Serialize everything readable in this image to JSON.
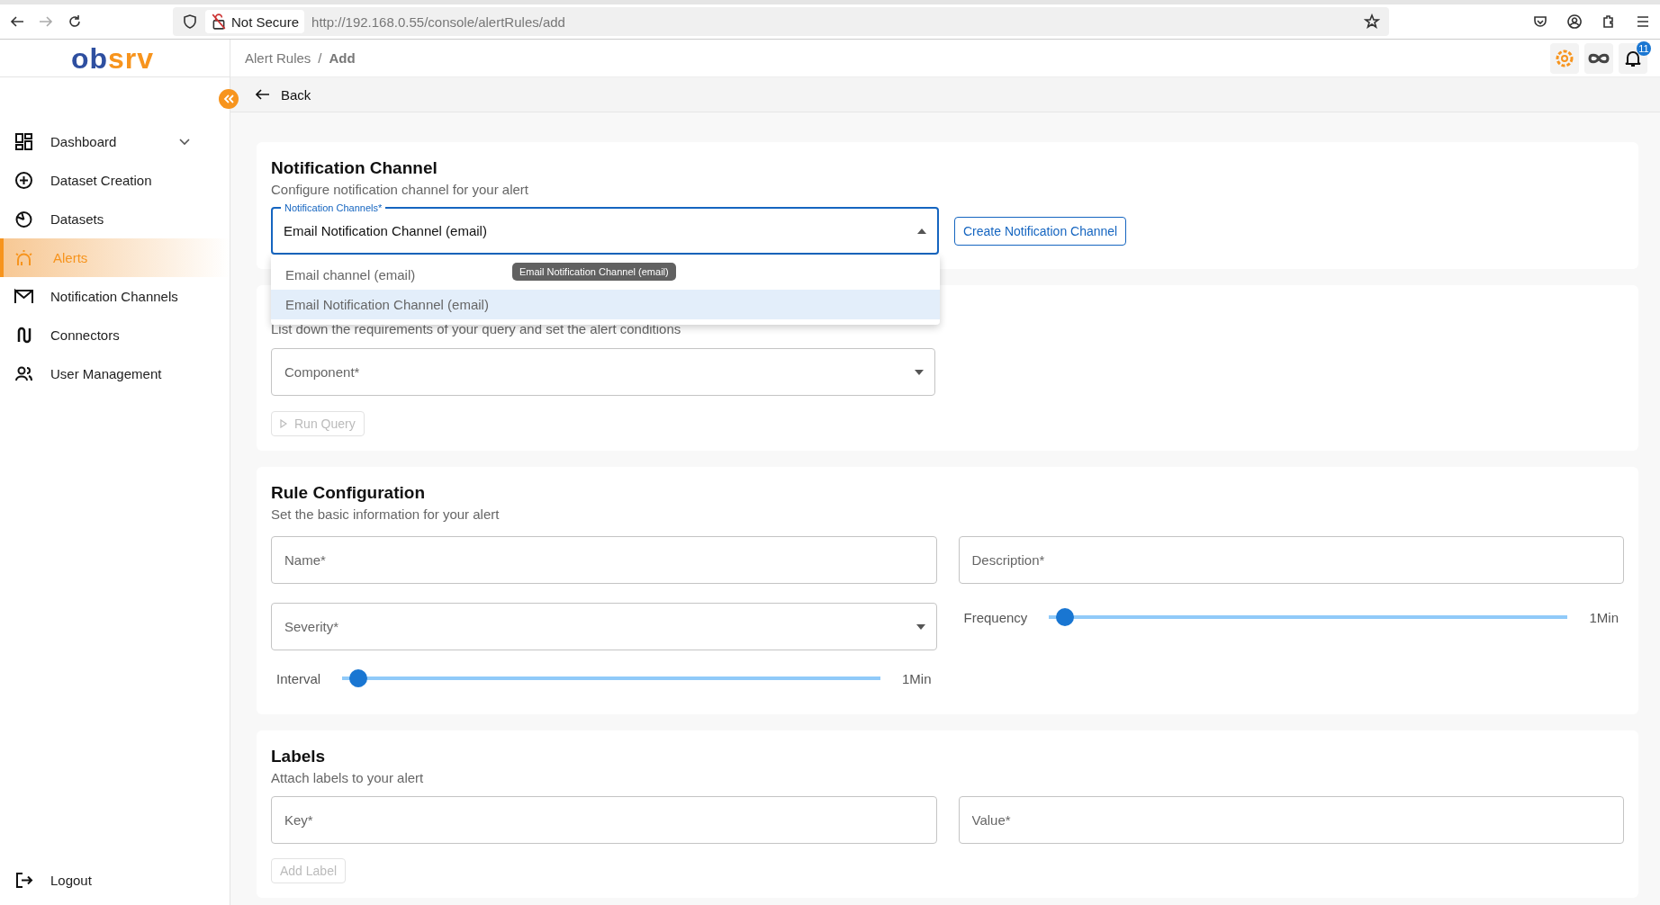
{
  "browser": {
    "security": "Not Secure",
    "url": "http://192.168.0.55/console/alertRules/add"
  },
  "logo": [
    "ob",
    "srv"
  ],
  "header": {
    "breadcrumbs": [
      {
        "label": "Alert Rules",
        "current": false
      },
      {
        "label": "Add",
        "current": true
      }
    ],
    "separator": "/",
    "notification_count": "11"
  },
  "back": "Back",
  "sidebar": {
    "items": [
      {
        "label": "Dashboard",
        "selected": false,
        "expanded": false
      },
      {
        "label": "Dataset Creation",
        "selected": false
      },
      {
        "label": "Datasets",
        "selected": false
      },
      {
        "label": "Alerts",
        "selected": true
      },
      {
        "label": "Notification Channels",
        "selected": false
      },
      {
        "label": "Connectors",
        "selected": false
      },
      {
        "label": "User Management",
        "selected": false
      }
    ],
    "logout": "Logout"
  },
  "notification_channel": {
    "title": "Notification Channel",
    "subtitle": "Configure notification channel for your alert",
    "select": {
      "label": "Notification Channels*",
      "value": "Email Notification Channel (email)",
      "open": true
    },
    "button": "Create Notification Channel",
    "options": [
      {
        "label": "Email channel (email)",
        "selected": false
      },
      {
        "label": "Email Notification Channel (email)",
        "selected": true
      }
    ],
    "tooltip": "Email Notification Channel (email)"
  },
  "query": {
    "subtitle": "List down the requirements of your query and set the alert conditions",
    "component": {
      "placeholder": "Component*"
    },
    "button": {
      "label": "Run Query",
      "disabled": true
    }
  },
  "rule_configuration": {
    "title": "Rule Configuration",
    "subtitle": "Set the basic information for your alert",
    "name": {
      "placeholder": "Name*"
    },
    "description": {
      "placeholder": "Description*"
    },
    "severity": {
      "placeholder": "Severity*"
    },
    "frequency": {
      "label": "Frequency",
      "level": 0.03,
      "reading": "1Min"
    },
    "interval": {
      "label": "Interval",
      "level": 0.03,
      "reading": "1Min"
    }
  },
  "labels": {
    "title": "Labels",
    "subtitle": "Attach labels to your alert",
    "key": {
      "placeholder": "Key*"
    },
    "value": {
      "placeholder": "Value*"
    },
    "button": {
      "label": "Add Label",
      "disabled": true
    }
  }
}
